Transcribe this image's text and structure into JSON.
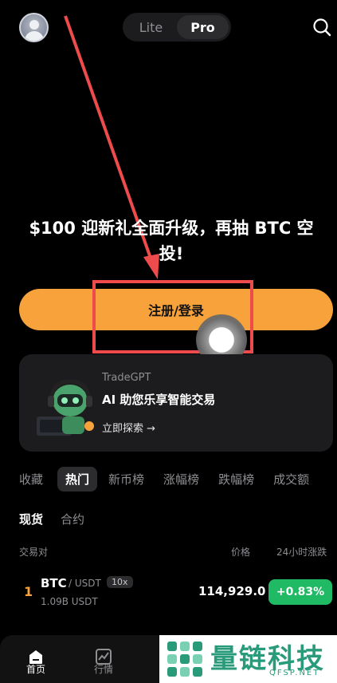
{
  "header": {
    "modes": [
      {
        "label": "Lite",
        "active": false
      },
      {
        "label": "Pro",
        "active": true
      }
    ]
  },
  "promo": {
    "title": "$100 迎新礼全面升级，再抽 BTC 空投!",
    "cta_label": "注册/登录"
  },
  "gpt_card": {
    "brand": "TradeGPT",
    "title": "AI 助您乐享智能交易",
    "link": "立即探索 →"
  },
  "categories": [
    "收藏",
    "热门",
    "新币榜",
    "涨幅榜",
    "跌幅榜",
    "成交额"
  ],
  "sub_tabs": [
    "现货",
    "合约"
  ],
  "columns": {
    "pair": "交易对",
    "price": "价格",
    "change": "24小时涨跌"
  },
  "market_rows": [
    {
      "rank": "1",
      "symbol": "BTC",
      "quote": "/ USDT",
      "leverage": "10x",
      "volume": "1.09B USDT",
      "price": "114,929.0",
      "change": "+0.83%"
    }
  ],
  "nav": {
    "home": "首页",
    "market": "行情"
  },
  "watermark": {
    "text": "量链科技",
    "sub": "QFSP.NET"
  },
  "colors": {
    "accent": "#f7a23b",
    "positive": "#20b964",
    "annotation": "#ee4c4c",
    "watermark": "#2a9b7a"
  }
}
